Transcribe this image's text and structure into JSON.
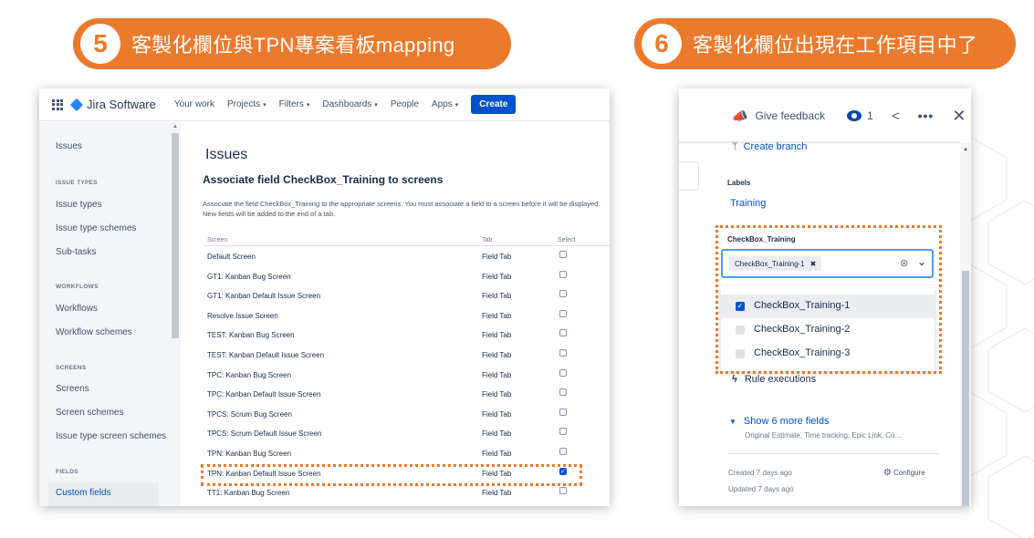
{
  "banners": [
    {
      "number": "5",
      "text": "客製化欄位與TPN專案看板mapping"
    },
    {
      "number": "6",
      "text": "客製化欄位出現在工作項目中了"
    }
  ],
  "jira": {
    "app_name": "Jira Software",
    "nav": [
      "Your work",
      "Projects",
      "Filters",
      "Dashboards",
      "People",
      "Apps"
    ],
    "create_label": "Create",
    "sidebar": {
      "top": "Issues",
      "issue_types_head": "ISSUE TYPES",
      "issue_types": "Issue types",
      "issue_type_schemes": "Issue type schemes",
      "sub_tasks": "Sub-tasks",
      "workflows_head": "WORKFLOWS",
      "workflows": "Workflows",
      "workflow_schemes": "Workflow schemes",
      "screens_head": "SCREENS",
      "screens": "Screens",
      "screen_schemes": "Screen schemes",
      "issue_type_screen_schemes": "Issue type screen schemes",
      "fields_head": "FIELDS",
      "custom_fields": "Custom fields"
    },
    "page_title": "Issues",
    "subtitle": "Associate field CheckBox_Training to screens",
    "description": "Associate the field CheckBox_Training to the appropriate screens. You must associate a field to a screen before it will be displayed. New fields will be added to the end of a tab.",
    "columns": {
      "screen": "Screen",
      "tab": "Tab",
      "select": "Select"
    },
    "rows": [
      {
        "screen": "Default Screen",
        "tab": "Field Tab",
        "checked": false
      },
      {
        "screen": "GT1: Kanban Bug Screen",
        "tab": "Field Tab",
        "checked": false
      },
      {
        "screen": "GT1: Kanban Default Issue Screen",
        "tab": "Field Tab",
        "checked": false
      },
      {
        "screen": "Resolve Issue Screen",
        "tab": "Field Tab",
        "checked": false
      },
      {
        "screen": "TEST: Kanban Bug Screen",
        "tab": "Field Tab",
        "checked": false
      },
      {
        "screen": "TEST: Kanban Default Issue Screen",
        "tab": "Field Tab",
        "checked": false
      },
      {
        "screen": "TPC: Kanban Bug Screen",
        "tab": "Field Tab",
        "checked": false
      },
      {
        "screen": "TPC: Kanban Default Issue Screen",
        "tab": "Field Tab",
        "checked": false
      },
      {
        "screen": "TPCS: Scrum Bug Screen",
        "tab": "Field Tab",
        "checked": false
      },
      {
        "screen": "TPCS: Scrum Default Issue Screen",
        "tab": "Field Tab",
        "checked": false
      },
      {
        "screen": "TPN: Kanban Bug Screen",
        "tab": "Field Tab",
        "checked": false
      },
      {
        "screen": "TPN: Kanban Default Issue Screen",
        "tab": "Field Tab",
        "checked": true
      },
      {
        "screen": "TT1: Kanban Bug Screen",
        "tab": "Field Tab",
        "checked": false
      }
    ]
  },
  "issue": {
    "give_feedback": "Give feedback",
    "watch_count": "1",
    "more_glyph": "•••",
    "close_glyph": "✕",
    "create_branch": "Create branch",
    "labels_label": "Labels",
    "labels_value": "Training",
    "checkbox_label": "CheckBox_Training",
    "chip_text": "CheckBox_Training-1",
    "chip_remove": "✖",
    "options": [
      {
        "label": "CheckBox_Training-1",
        "checked": true
      },
      {
        "label": "CheckBox_Training-2",
        "checked": false
      },
      {
        "label": "CheckBox_Training-3",
        "checked": false
      }
    ],
    "rule_executions": "Rule executions",
    "show_more": "Show 6 more fields",
    "show_more_sub": "Original Estimate, Time tracking, Epic Link, Co...",
    "created": "Created 7 days ago",
    "updated": "Updated 7 days ago",
    "configure": "Configure"
  },
  "colors": {
    "banner": "#ec7a2d",
    "highlight": "#e67a2e",
    "jira_blue": "#0052cc"
  }
}
